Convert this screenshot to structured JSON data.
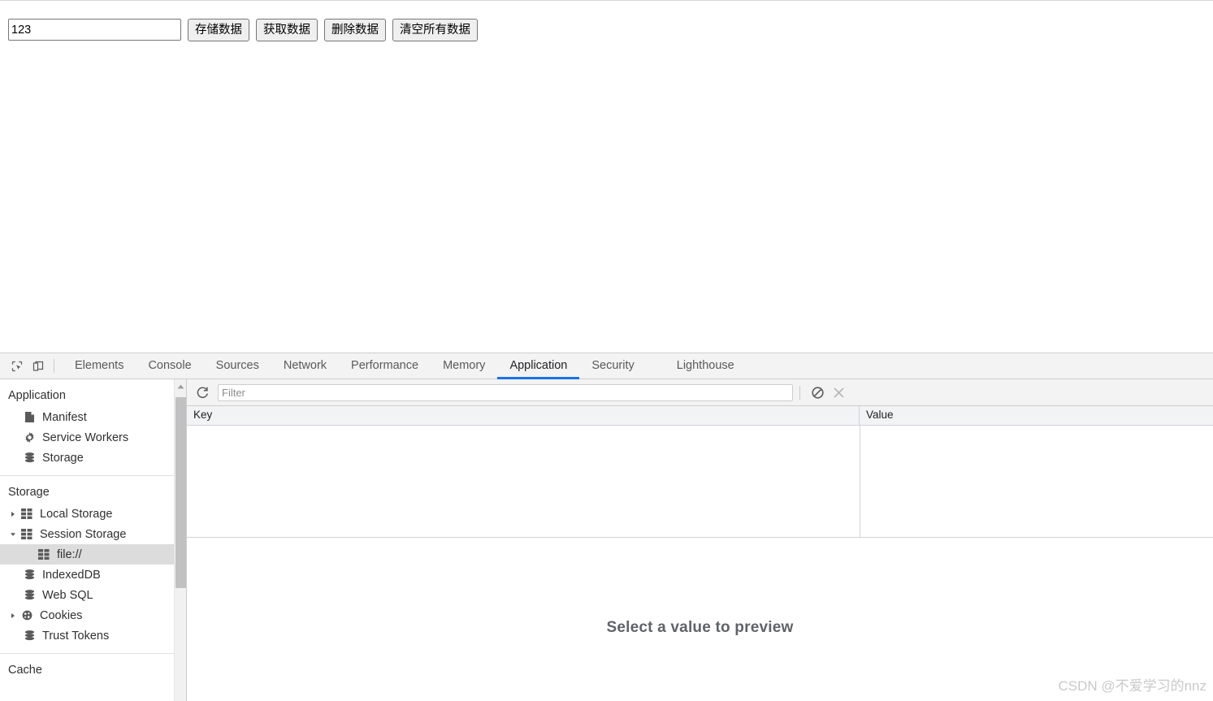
{
  "page": {
    "input": {
      "value": "123",
      "placeholder": ""
    },
    "buttons": [
      {
        "name": "store-data-button",
        "label": "存储数据"
      },
      {
        "name": "get-data-button",
        "label": "获取数据"
      },
      {
        "name": "delete-data-button",
        "label": "删除数据"
      },
      {
        "name": "clear-all-data-button",
        "label": "清空所有数据"
      }
    ]
  },
  "devtools": {
    "tabs": [
      {
        "label": "Elements",
        "active": false,
        "gapped": false
      },
      {
        "label": "Console",
        "active": false,
        "gapped": false
      },
      {
        "label": "Sources",
        "active": false,
        "gapped": false
      },
      {
        "label": "Network",
        "active": false,
        "gapped": false
      },
      {
        "label": "Performance",
        "active": false,
        "gapped": false
      },
      {
        "label": "Memory",
        "active": false,
        "gapped": false
      },
      {
        "label": "Application",
        "active": true,
        "gapped": false
      },
      {
        "label": "Security",
        "active": false,
        "gapped": false
      },
      {
        "label": "Lighthouse",
        "active": false,
        "gapped": true
      }
    ],
    "sidebar": {
      "application_section": {
        "title": "Application",
        "items": [
          {
            "label": "Manifest",
            "icon": "document-icon",
            "arrow": "none",
            "selected": false
          },
          {
            "label": "Service Workers",
            "icon": "gear-icon",
            "arrow": "none",
            "selected": false
          },
          {
            "label": "Storage",
            "icon": "database-icon",
            "arrow": "none",
            "selected": false
          }
        ]
      },
      "storage_section": {
        "title": "Storage",
        "items": [
          {
            "label": "Local Storage",
            "icon": "table-icon",
            "arrow": "collapsed",
            "selected": false,
            "indent": 0
          },
          {
            "label": "Session Storage",
            "icon": "table-icon",
            "arrow": "expanded",
            "selected": false,
            "indent": 0
          },
          {
            "label": "file://",
            "icon": "table-icon",
            "arrow": "none",
            "selected": true,
            "indent": 1
          },
          {
            "label": "IndexedDB",
            "icon": "database-icon",
            "arrow": "none",
            "selected": false,
            "indent": 0
          },
          {
            "label": "Web SQL",
            "icon": "database-icon",
            "arrow": "none",
            "selected": false,
            "indent": 0
          },
          {
            "label": "Cookies",
            "icon": "cookie-icon",
            "arrow": "collapsed",
            "selected": false,
            "indent": 0
          },
          {
            "label": "Trust Tokens",
            "icon": "database-icon",
            "arrow": "none",
            "selected": false,
            "indent": 0
          }
        ]
      },
      "cache_section": {
        "title": "Cache"
      }
    },
    "storage_toolbar": {
      "refresh_title": "Refresh",
      "filter_placeholder": "Filter",
      "filter_value": "",
      "clear_all_title": "Clear All",
      "delete_selected_title": "Delete Selected"
    },
    "datagrid": {
      "columns": [
        "Key",
        "Value"
      ],
      "rows": []
    },
    "preview": {
      "message": "Select a value to preview"
    }
  },
  "watermark": {
    "text": "CSDN @不爱学习的nnz"
  },
  "colors": {
    "accent": "#1a73e8",
    "selected_row": "#dcdcdc",
    "toolbar_bg": "#f3f3f3",
    "border": "#cdcdcd"
  }
}
